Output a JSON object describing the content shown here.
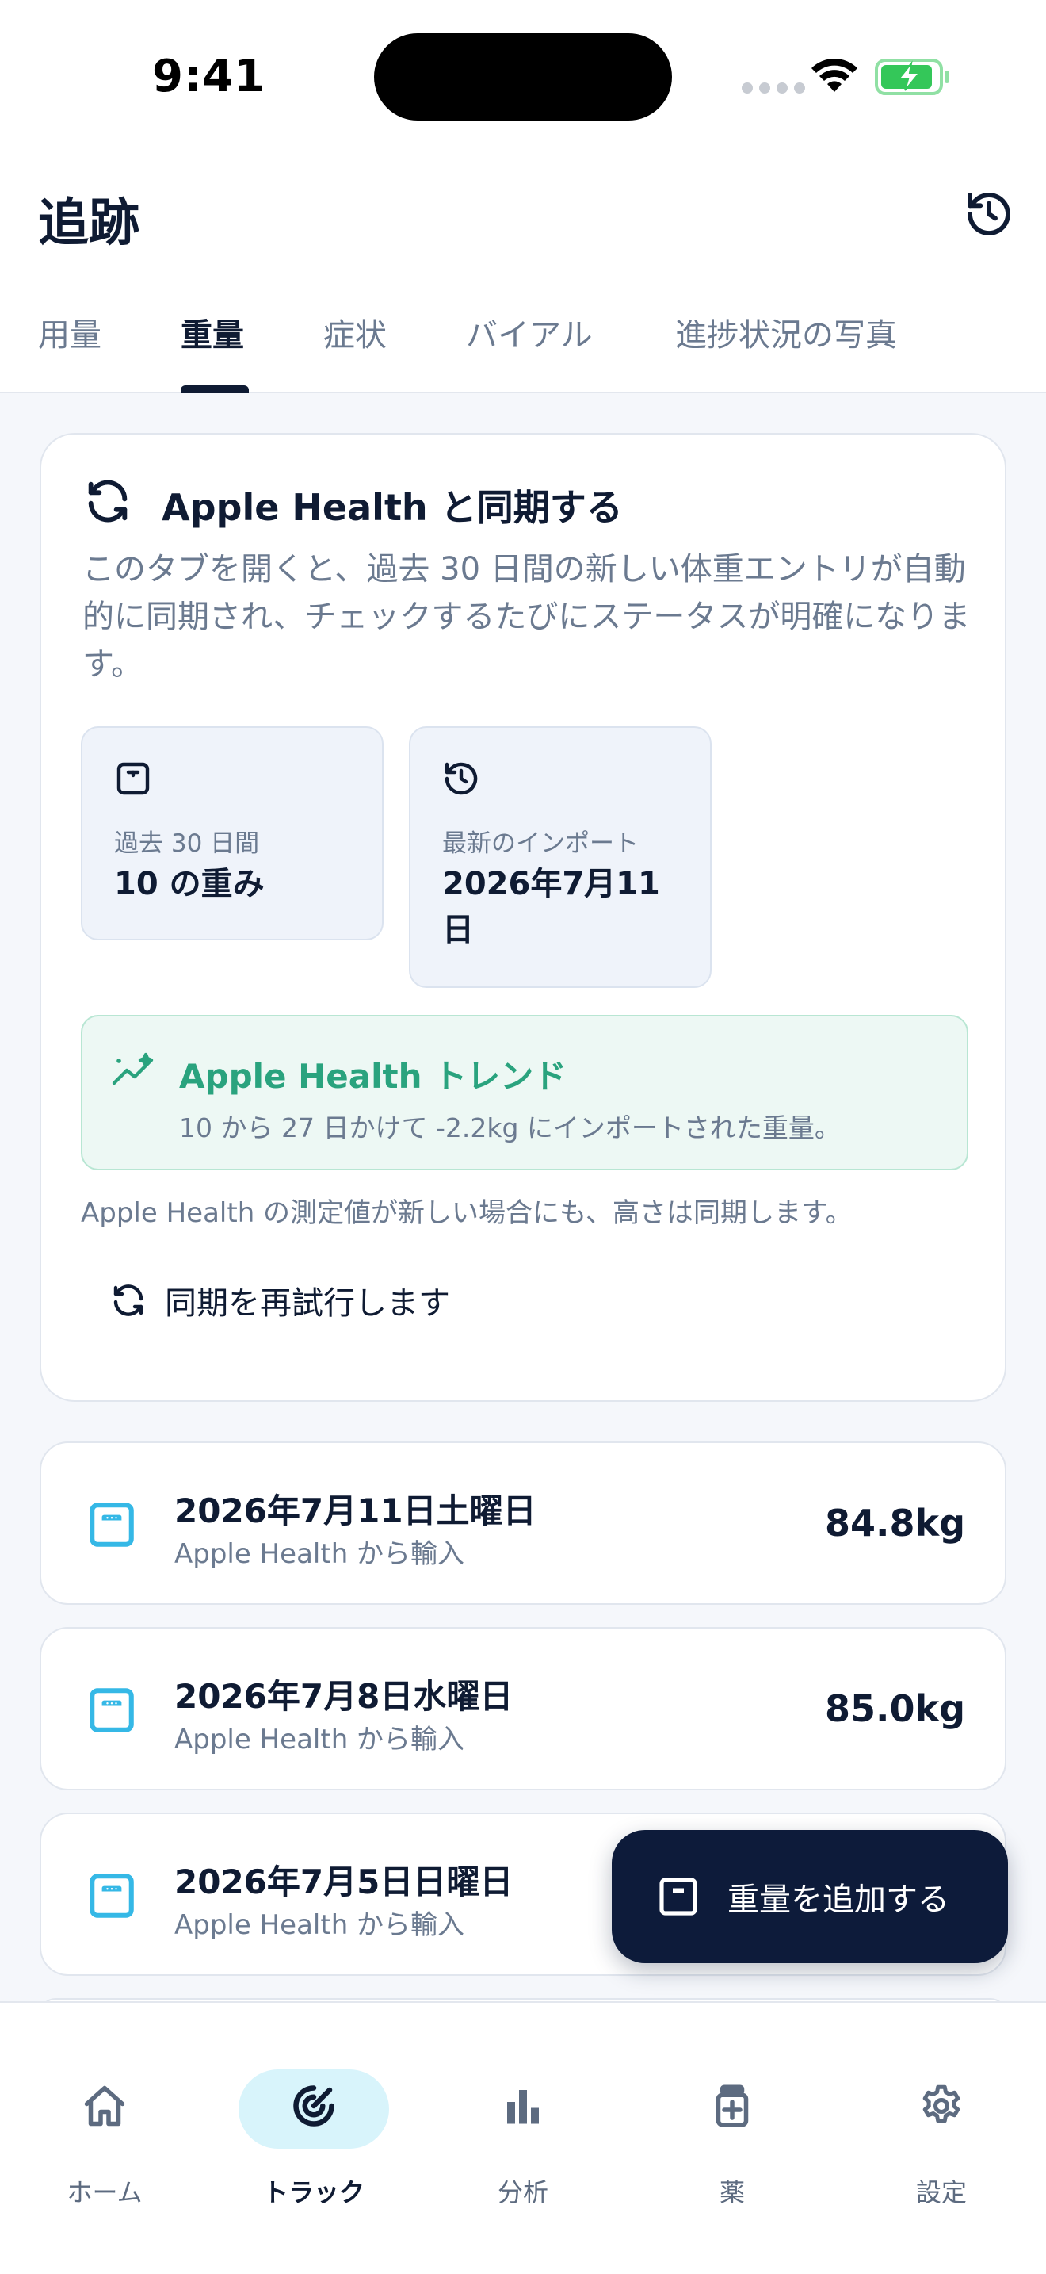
{
  "status_bar": {
    "time": "9:41"
  },
  "header": {
    "title": "追跡"
  },
  "tabs": [
    {
      "label": "用量",
      "active": false
    },
    {
      "label": "重量",
      "active": true
    },
    {
      "label": "症状",
      "active": false
    },
    {
      "label": "バイアル",
      "active": false
    },
    {
      "label": "進捗状況の写真",
      "active": false
    }
  ],
  "sync_card": {
    "title": "Apple Health と同期する",
    "description": "このタブを開くと、過去 30 日間の新しい体重エントリが自動的に同期され、チェックするたびにステータスが明確になります。",
    "stats": [
      {
        "icon": "scale-icon",
        "label": "過去 30 日間",
        "value": "10 の重み"
      },
      {
        "icon": "history-icon",
        "label": "最新のインポート",
        "value": "2026年7月11日"
      }
    ],
    "trend": {
      "title": "Apple Health トレンド",
      "text": "10 から 27 日かけて -2.2kg にインポートされた重量。"
    },
    "note": "Apple Health の測定値が新しい場合にも、高さは同期します。",
    "retry_label": "同期を再試行します"
  },
  "entries": [
    {
      "date": "2026年7月11日土曜日",
      "source": "Apple Health から輸入",
      "weight": "84.8kg"
    },
    {
      "date": "2026年7月8日水曜日",
      "source": "Apple Health から輸入",
      "weight": "85.0kg"
    },
    {
      "date": "2026年7月5日日曜日",
      "source": "Apple Health から輸入",
      "weight": ""
    }
  ],
  "fab": {
    "label": "重量を追加する"
  },
  "bottom_nav": [
    {
      "label": "ホーム",
      "icon": "home-icon",
      "active": false
    },
    {
      "label": "トラック",
      "icon": "target-icon",
      "active": true
    },
    {
      "label": "分析",
      "icon": "bar-chart-icon",
      "active": false
    },
    {
      "label": "薬",
      "icon": "medicine-icon",
      "active": false
    },
    {
      "label": "設定",
      "icon": "gear-icon",
      "active": false
    }
  ],
  "colors": {
    "primary": "#0d1b3a",
    "accent_green": "#2aa37e",
    "accent_cyan": "#35b8e6",
    "muted_text": "#6b7a90",
    "battery_green": "#34c759"
  }
}
